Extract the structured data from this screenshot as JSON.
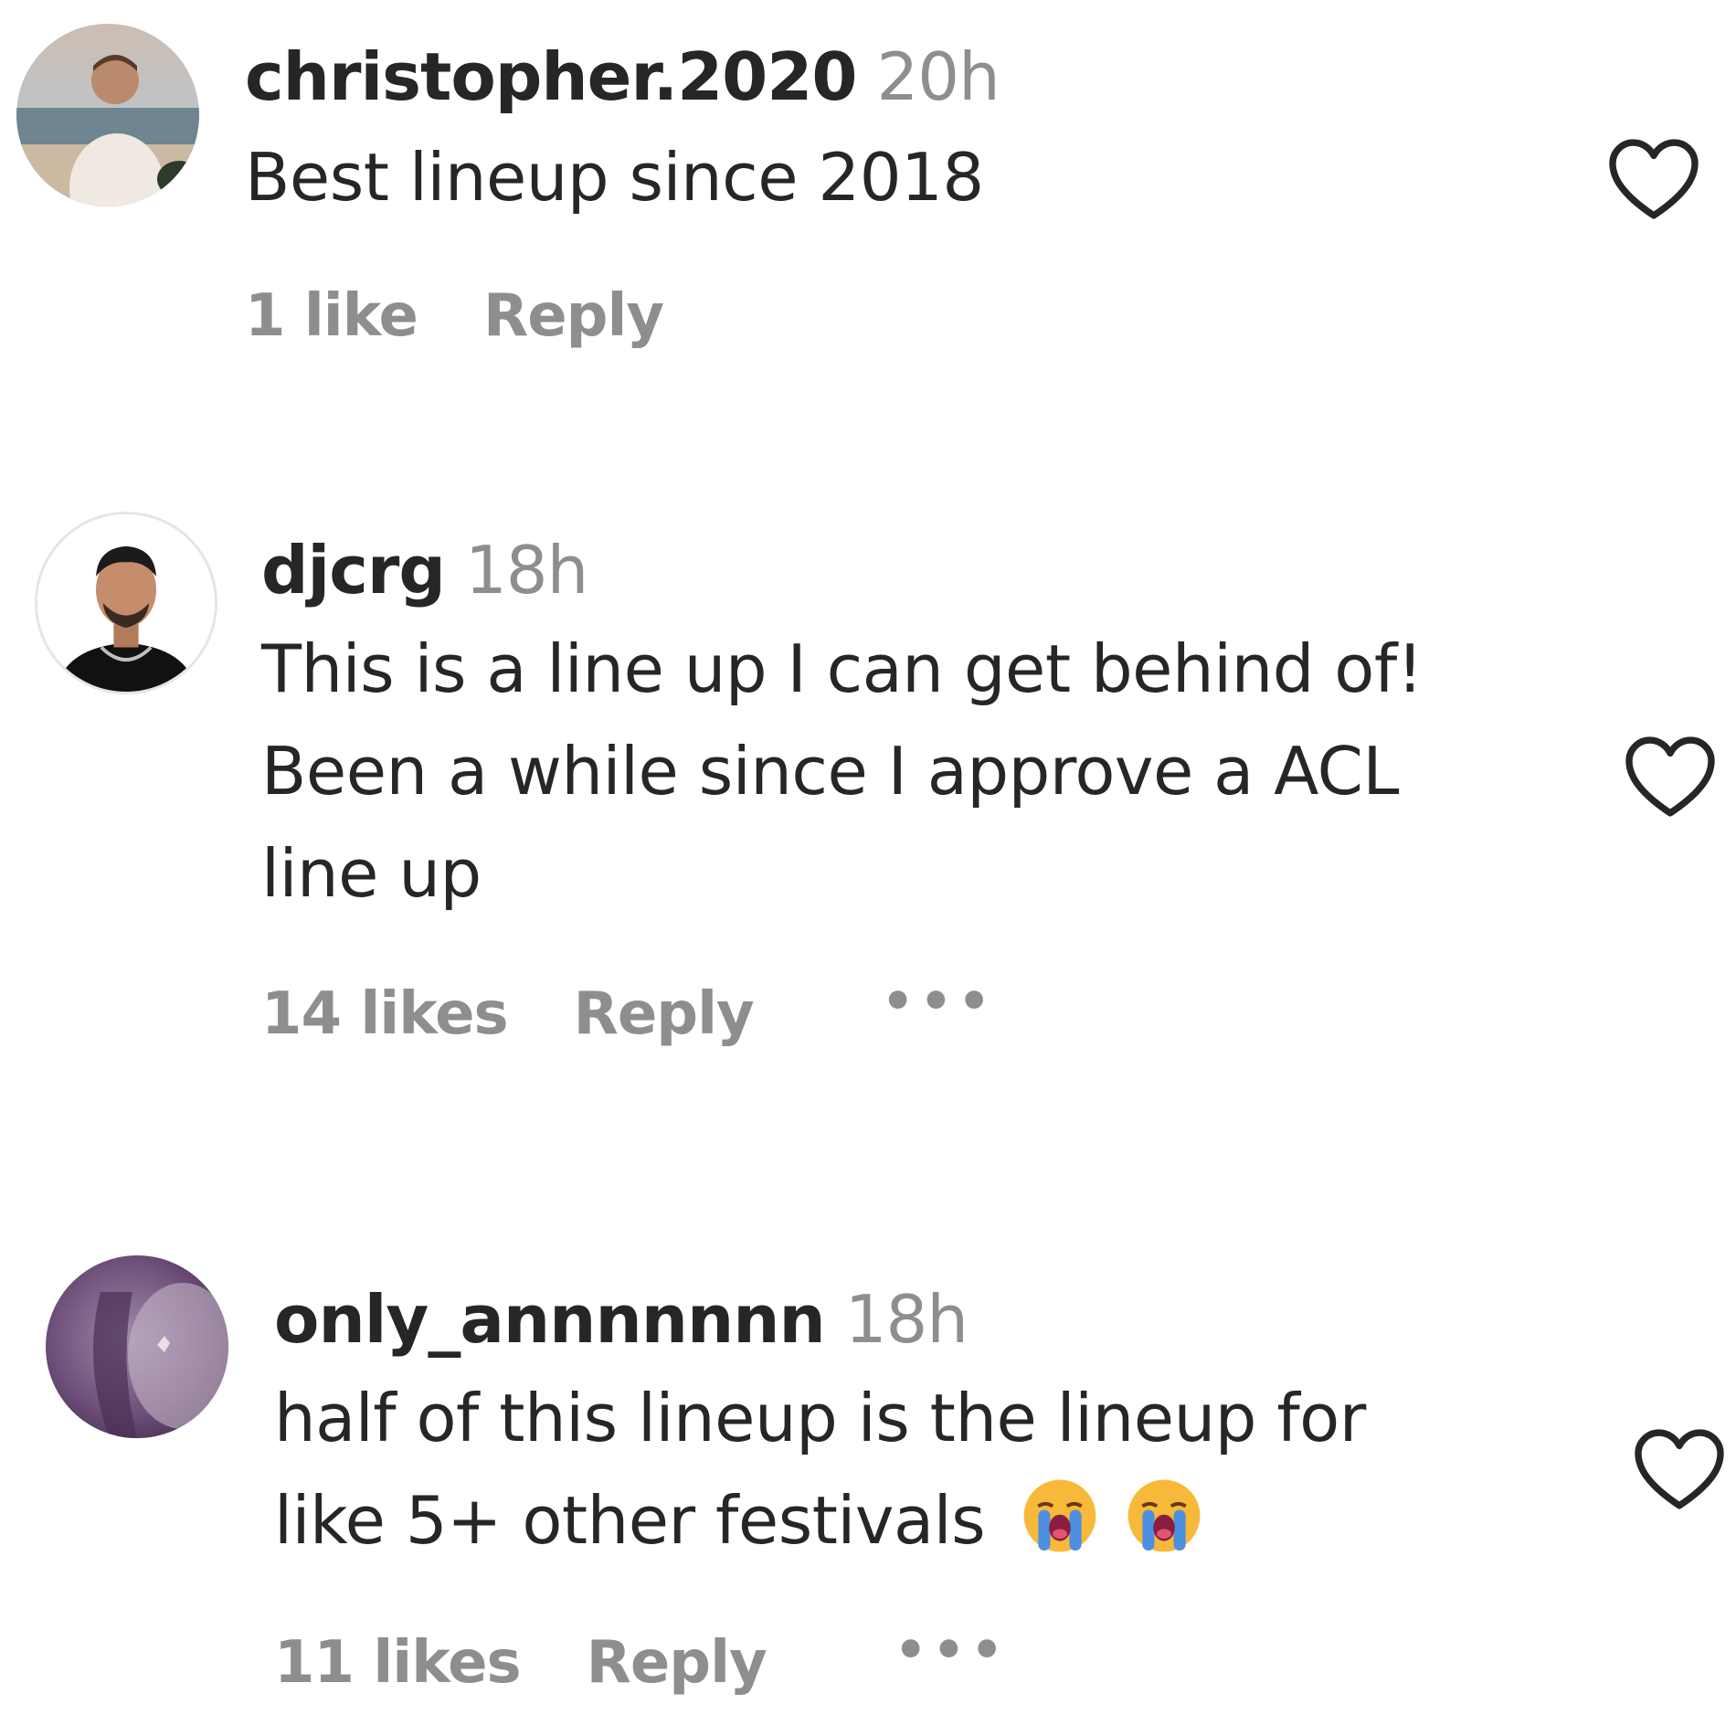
{
  "comments": [
    {
      "username": "christopher.2020",
      "time": "20h",
      "text_lines": [
        "Best lineup since 2018"
      ],
      "likes": "1 like",
      "reply_label": "Reply",
      "more_label": "",
      "avatar_icon": "profile-photo-beach"
    },
    {
      "username": "djcrg",
      "time": "18h",
      "text_lines": [
        "This is a line up I can get behind of!",
        "Been a while since I approve a ACL",
        "line up"
      ],
      "likes": "14 likes",
      "reply_label": "Reply",
      "more_label": "•••",
      "avatar_icon": "profile-photo-man"
    },
    {
      "username": "only_annnnnnn",
      "time": "18h",
      "text_lines": [
        "half of this lineup is the lineup for",
        "like 5+ other festivals"
      ],
      "emojis": [
        "😭",
        "😭"
      ],
      "likes": "11 likes",
      "reply_label": "Reply",
      "more_label": "•••",
      "avatar_icon": "profile-photo-purple"
    }
  ],
  "colors": {
    "text": "#262626",
    "muted": "#8e8e8e",
    "heart_outline": "#262626"
  },
  "icons": {
    "like": "heart-outline-icon",
    "emoji": "loudly-crying-face-emoji"
  }
}
